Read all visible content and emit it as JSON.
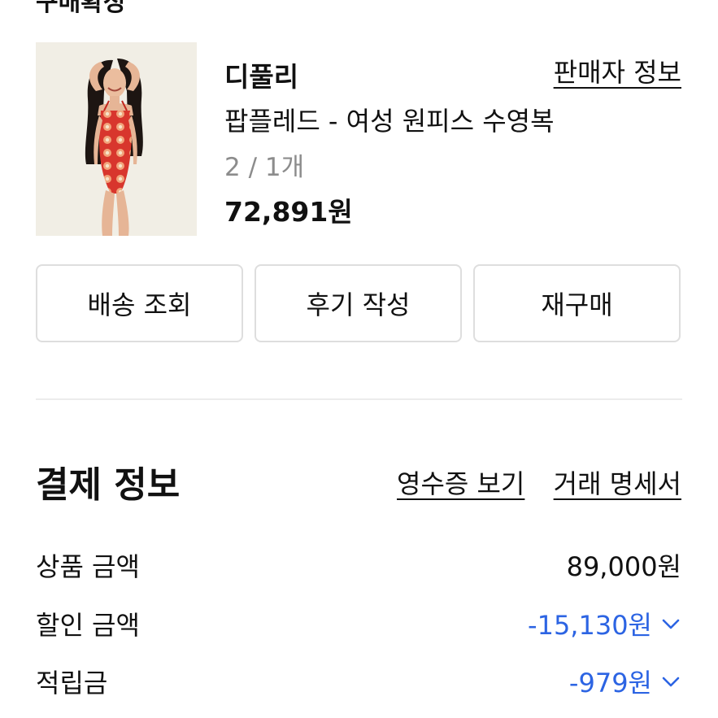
{
  "order_header": {
    "cut_title": "구매확정"
  },
  "product": {
    "seller_name": "디풀리",
    "seller_info_link": "판매자 정보",
    "product_name": "팝플레드 - 여성 원피스 수영복",
    "option_qty": "2 / 1개",
    "price": "72,891원",
    "image_description_icon": "swimsuit-photo"
  },
  "actions": {
    "track_delivery": "배송 조회",
    "write_review": "후기 작성",
    "rebuy": "재구매"
  },
  "payment": {
    "title": "결제 정보",
    "receipt_link": "영수증 보기",
    "statement_link": "거래 명세서",
    "rows": [
      {
        "label": "상품 금액",
        "value": "89,000원"
      },
      {
        "label": "할인 금액",
        "value": "-15,130원"
      },
      {
        "label": "적립금",
        "value": "-979원"
      }
    ]
  },
  "colors": {
    "accent_blue": "#2c64e3",
    "border": "#dedede",
    "muted_text": "#8c8c8c"
  }
}
